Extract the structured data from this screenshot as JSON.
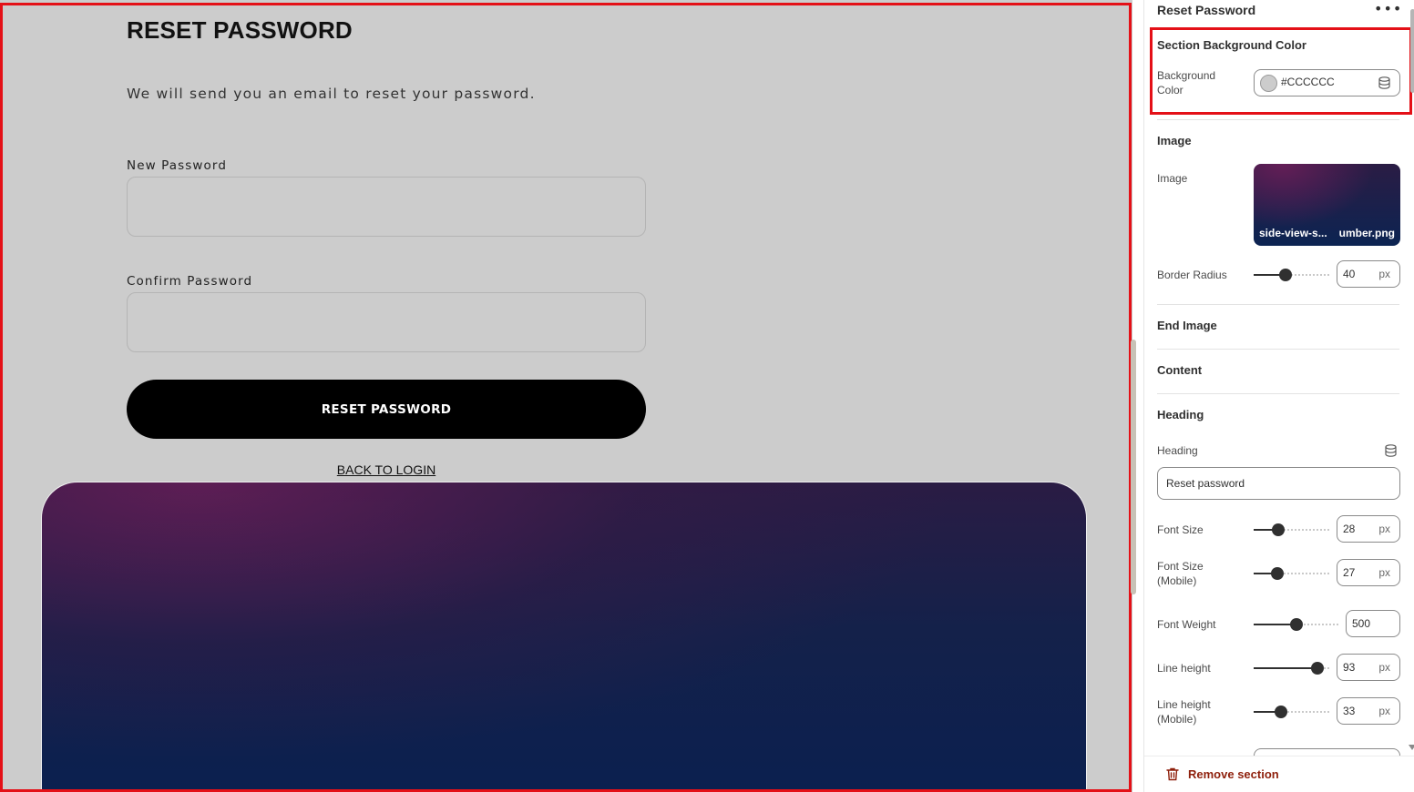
{
  "preview": {
    "heading": "RESET PASSWORD",
    "subtitle": "We will send you an email to reset your password.",
    "new_password_label": "New Password",
    "confirm_password_label": "Confirm Password",
    "submit_label": "RESET PASSWORD",
    "back_link": "BACK TO LOGIN",
    "background_color": "#CCCCCC"
  },
  "sidebar": {
    "title": "Reset Password",
    "more_icon": "more-horizontal-icon",
    "sections": {
      "background": {
        "title": "Section Background Color",
        "color_label": "Background Color",
        "color_value": "#CCCCCC"
      },
      "image": {
        "title": "Image",
        "image_label": "Image",
        "file_name_start": "side-view-s...",
        "file_name_end": "umber.png",
        "border_radius_label": "Border Radius",
        "border_radius_value": "40",
        "border_radius_unit": "px",
        "border_radius_level": 0.42
      },
      "end_image": {
        "title": "End Image"
      },
      "content": {
        "title": "Content"
      },
      "heading": {
        "title": "Heading",
        "heading_label": "Heading",
        "heading_value": "Reset password",
        "font_size_label": "Font Size",
        "font_size_value": "28",
        "font_size_level": 0.32,
        "font_size_mobile_label": "Font Size (Mobile)",
        "font_size_mobile_value": "27",
        "font_size_mobile_level": 0.31,
        "font_weight_label": "Font Weight",
        "font_weight_value": "500",
        "font_weight_level": 0.5,
        "line_height_label": "Line height",
        "line_height_value": "93",
        "line_height_level": 0.84,
        "line_height_mobile_label": "Line height (Mobile)",
        "line_height_mobile_value": "33",
        "line_height_mobile_level": 0.36,
        "unit": "px"
      }
    },
    "remove_label": "Remove section"
  },
  "colors": {
    "highlight": "#e41017",
    "remove": "#8e1f0b",
    "button": "#000000"
  }
}
